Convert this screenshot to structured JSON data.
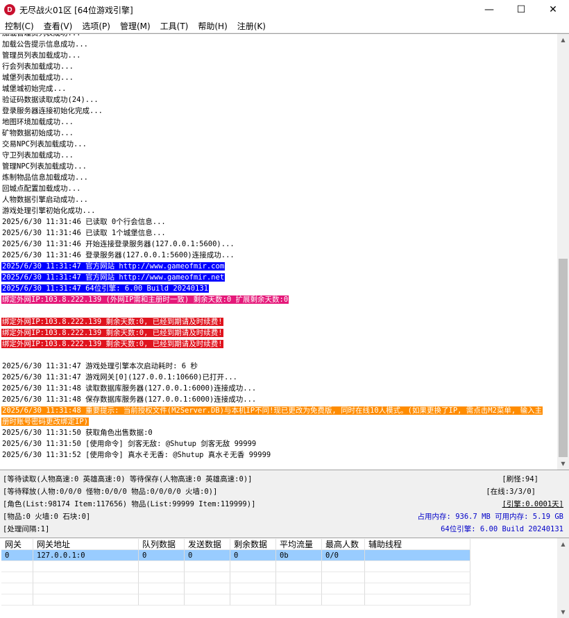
{
  "window": {
    "title": "无尽战火01区 [64位游戏引擎]",
    "icon_letter": "D",
    "icon_color": "#c8102e",
    "minimize": "—",
    "maximize": "☐",
    "close": "✕"
  },
  "menu": [
    "控制(C)",
    "查看(V)",
    "选项(P)",
    "管理(M)",
    "工具(T)",
    "帮助(H)",
    "注册(K)"
  ],
  "log": [
    {
      "text": "加载管理员列表成功...",
      "style": ""
    },
    {
      "text": "加载公告提示信息成功...",
      "style": ""
    },
    {
      "text": "管理员列表加载成功...",
      "style": ""
    },
    {
      "text": "行会列表加载成功...",
      "style": ""
    },
    {
      "text": "城堡列表加载成功...",
      "style": ""
    },
    {
      "text": "城堡城初始完成...",
      "style": ""
    },
    {
      "text": "验证码数据读取成功(24)...",
      "style": ""
    },
    {
      "text": "登录服务器连接初始化完成...",
      "style": ""
    },
    {
      "text": "地图环境加载成功...",
      "style": ""
    },
    {
      "text": "矿物数据初始成功...",
      "style": ""
    },
    {
      "text": "交易NPC列表加载成功...",
      "style": ""
    },
    {
      "text": "守卫列表加载成功...",
      "style": ""
    },
    {
      "text": "管理NPC列表加载成功...",
      "style": ""
    },
    {
      "text": "炼制物品信息加载成功...",
      "style": ""
    },
    {
      "text": "回城点配置加载成功...",
      "style": ""
    },
    {
      "text": "人物数据引擎启动成功...",
      "style": ""
    },
    {
      "text": "游戏处理引擎初始化成功...",
      "style": ""
    },
    {
      "text": "2025/6/30 11:31:46 已读取 0个行会信息...",
      "style": ""
    },
    {
      "text": "2025/6/30 11:31:46 已读取 1个城堡信息...",
      "style": ""
    },
    {
      "text": "2025/6/30 11:31:46 开始连接登录服务器(127.0.0.1:5600)...",
      "style": ""
    },
    {
      "text": "2025/6/30 11:31:46 登录服务器(127.0.0.1:5600)连接成功...",
      "style": ""
    },
    {
      "text": "2025/6/30 11:31:47 官方网站 http://www.gameofmir.com",
      "style": "blue"
    },
    {
      "text": "2025/6/30 11:31:47 官方网站 http://www.gameofmir.net",
      "style": "blue"
    },
    {
      "text": "2025/6/30 11:31:47 64位引擎: 6.00 Build 20240131",
      "style": "blue"
    },
    {
      "text": "绑定外网IP:103.8.222.139 (外网IP需和主册时一致) 剩余天数:0 扩展剩余天数:0",
      "style": "magenta"
    },
    {
      "text": "",
      "style": ""
    },
    {
      "text": "绑定外网IP:103.8.222.139 剩余天数:0, 已经到期请及时续费!",
      "style": "red"
    },
    {
      "text": "绑定外网IP:103.8.222.139 剩余天数:0, 已经到期请及时续费!",
      "style": "red"
    },
    {
      "text": "绑定外网IP:103.8.222.139 剩余天数:0, 已经到期请及时续费!",
      "style": "red"
    },
    {
      "text": "",
      "style": ""
    },
    {
      "text": "2025/6/30 11:31:47 游戏处理引擎本次启动耗时: 6 秒",
      "style": ""
    },
    {
      "text": "2025/6/30 11:31:47 游戏网关[0](127.0.0.1:10660)已打开...",
      "style": ""
    },
    {
      "text": "2025/6/30 11:31:48 读取数据库服务器(127.0.0.1:6000)连接成功...",
      "style": ""
    },
    {
      "text": "2025/6/30 11:31:48 保存数据库服务器(127.0.0.1:6000)连接成功...",
      "style": ""
    },
    {
      "text": "2025/6/30 11:31:48 重要提示: 当前授权文件(M2Server.DB)与本机IP不同!现已更改为免费版, 同时在线10人模式。(如果更换了IP, 需点击M2菜单, 输入主册时账号密码更改绑定IP)",
      "style": "orange-wrap"
    },
    {
      "text": "2025/6/30 11:31:50 获取角色出售数据:0",
      "style": ""
    },
    {
      "text": "2025/6/30 11:31:50 [使用命令] 剑客无敌: @Shutup 剑客无敌 99999",
      "style": ""
    },
    {
      "text": "2025/6/30 11:31:52 [使用命令] 真水そ无香: @Shutup 真水そ无香 99999",
      "style": ""
    }
  ],
  "status": {
    "row1_left": "[等待读取(人物高速:0 英雄高速:0) 等待保存(人物高速:0 英雄高速:0)]",
    "row1_right": "[刷怪:94]",
    "row2_left": "[等待释放(人物:0/0/0 怪物:0/0/0 物品:0/0/0/0 火墙:0)]",
    "row2_right": "[在线:3/3/0]",
    "row3_left": "[角色(List:98174 Item:117656) 物品(List:99999 Item:119999)]",
    "row3_right": "[引擎:0.0001天]",
    "row4_left": "[物品:0 火墙:0 石块:0]",
    "row4_right": "占用内存: 936.7 MB 可用内存: 5.19 GB",
    "row5_left": "[处理间隔:1]",
    "row5_right": "64位引擎: 6.00 Build 20240131"
  },
  "gateway_table": {
    "columns": [
      "网关",
      "网关地址",
      "队列数据",
      "发送数据",
      "剩余数据",
      "平均流量",
      "最高人数",
      "辅助线程"
    ],
    "rows": [
      [
        "0",
        "127.0.0.1:0",
        "0",
        "0",
        "0",
        "0b",
        "0/0",
        ""
      ]
    ],
    "selected_row_color": "#99ccff"
  }
}
